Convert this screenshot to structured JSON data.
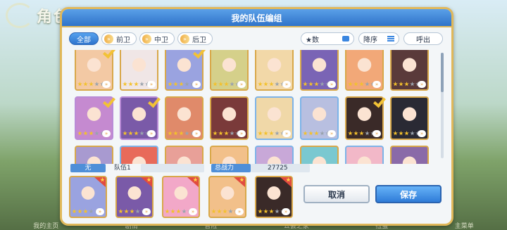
{
  "background": {
    "screen_title": "角色一览",
    "bottom_nav": [
      "我的主页",
      "剧情",
      "冒险",
      "公会之家",
      "扭蛋",
      "主菜单"
    ]
  },
  "modal": {
    "title": "我的队伍编组",
    "filters": [
      {
        "label": "全部",
        "active": true
      },
      {
        "label": "前卫",
        "active": false
      },
      {
        "label": "中卫",
        "active": false
      },
      {
        "label": "后卫",
        "active": false
      }
    ],
    "sort_key": "★数",
    "sort_order": "降序",
    "call_label": "呼出",
    "info": {
      "team_label": "无",
      "team_name": "队伍1",
      "power_label": "总战力",
      "power_value": "27725"
    },
    "cancel_label": "取消",
    "save_label": "保存",
    "colors": {
      "accent": "#2f74cd",
      "frame_gold": "#e0b85a",
      "check": "#f2c236"
    }
  },
  "roster": [
    {
      "row": 0,
      "col": 0,
      "stars": 3,
      "border": "gold",
      "selected": true,
      "hue": "#f3c9a4"
    },
    {
      "row": 0,
      "col": 1,
      "stars": 3,
      "border": "gold",
      "selected": false,
      "hue": "#f0e6e6"
    },
    {
      "row": 0,
      "col": 2,
      "stars": 3,
      "border": "gold",
      "selected": true,
      "hue": "#9aa3e0"
    },
    {
      "row": 0,
      "col": 3,
      "stars": 3,
      "border": "gold",
      "selected": false,
      "hue": "#d5d08a"
    },
    {
      "row": 0,
      "col": 4,
      "stars": 3,
      "border": "gold",
      "selected": false,
      "hue": "#f2d8a8"
    },
    {
      "row": 0,
      "col": 5,
      "stars": 3,
      "border": "gold",
      "selected": false,
      "hue": "#7a64b5"
    },
    {
      "row": 0,
      "col": 6,
      "stars": 3,
      "border": "gold",
      "selected": false,
      "hue": "#f2a878"
    },
    {
      "row": 0,
      "col": 7,
      "stars": 3,
      "border": "gold",
      "selected": false,
      "hue": "#5a3a3a"
    },
    {
      "row": 1,
      "col": 0,
      "stars": 3,
      "border": "purple",
      "selected": true,
      "hue": "#c58ad0"
    },
    {
      "row": 1,
      "col": 1,
      "stars": 3,
      "border": "purple",
      "selected": true,
      "hue": "#7a5aa8"
    },
    {
      "row": 1,
      "col": 2,
      "stars": 3,
      "border": "gold",
      "selected": false,
      "hue": "#e08a6a"
    },
    {
      "row": 1,
      "col": 3,
      "stars": 3,
      "border": "gold",
      "selected": false,
      "hue": "#7a3a3a"
    },
    {
      "row": 1,
      "col": 4,
      "stars": 3,
      "border": "blue",
      "selected": false,
      "hue": "#f0d8a8"
    },
    {
      "row": 1,
      "col": 5,
      "stars": 3,
      "border": "blue",
      "selected": false,
      "hue": "#b8bfe0"
    },
    {
      "row": 1,
      "col": 6,
      "stars": 3,
      "border": "gold",
      "selected": true,
      "hue": "#3a2a28"
    },
    {
      "row": 1,
      "col": 7,
      "stars": 3,
      "border": "gold",
      "selected": false,
      "hue": "#2a2a34"
    },
    {
      "row": 2,
      "col": 0,
      "stars": 3,
      "border": "gold",
      "selected": false,
      "hue": "#a89ad0"
    },
    {
      "row": 2,
      "col": 1,
      "stars": 3,
      "border": "blue",
      "selected": false,
      "hue": "#e86a5a"
    },
    {
      "row": 2,
      "col": 2,
      "stars": 3,
      "border": "gold",
      "selected": false,
      "hue": "#e8a098"
    },
    {
      "row": 2,
      "col": 3,
      "stars": 3,
      "border": "gold",
      "selected": false,
      "hue": "#f2c08a"
    },
    {
      "row": 2,
      "col": 4,
      "stars": 3,
      "border": "blue",
      "selected": false,
      "hue": "#c8a8d8"
    },
    {
      "row": 2,
      "col": 5,
      "stars": 3,
      "border": "gold",
      "selected": false,
      "hue": "#7ac8d0"
    },
    {
      "row": 2,
      "col": 6,
      "stars": 3,
      "border": "blue",
      "selected": false,
      "hue": "#f2b8c8"
    },
    {
      "row": 2,
      "col": 7,
      "stars": 3,
      "border": "gold",
      "selected": false,
      "hue": "#8a6aa8"
    }
  ],
  "team_slots": [
    {
      "slot": 1,
      "stars": 3,
      "hue": "#9aa3e0"
    },
    {
      "slot": 2,
      "stars": 3,
      "hue": "#7a5aa8"
    },
    {
      "slot": 3,
      "stars": 3,
      "hue": "#f2a8c8"
    },
    {
      "slot": 4,
      "stars": 3,
      "hue": "#f2c08a"
    },
    {
      "slot": 5,
      "stars": 3,
      "hue": "#3a2a28"
    }
  ]
}
